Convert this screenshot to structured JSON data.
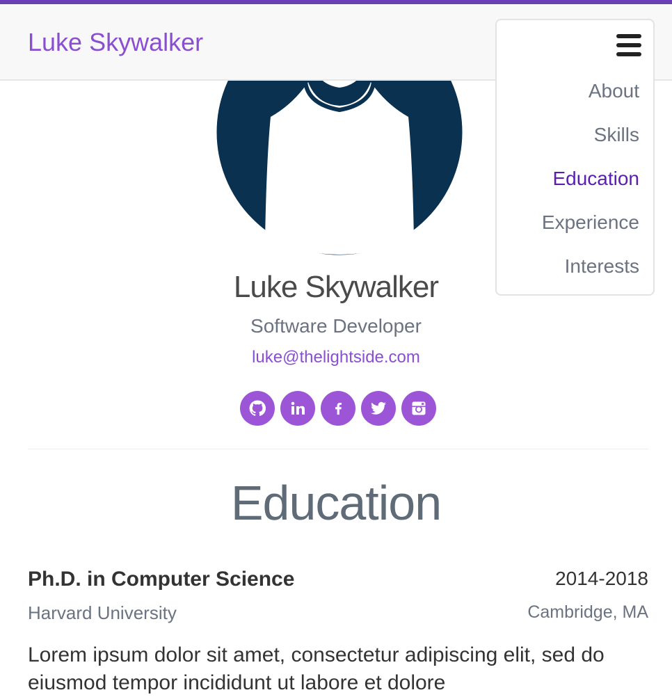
{
  "header": {
    "brand": "Luke Skywalker"
  },
  "nav": {
    "items": [
      {
        "label": "About",
        "active": false
      },
      {
        "label": "Skills",
        "active": false
      },
      {
        "label": "Education",
        "active": true
      },
      {
        "label": "Experience",
        "active": false
      },
      {
        "label": "Interests",
        "active": false
      }
    ],
    "toggle_icon": "hamburger-menu-icon"
  },
  "profile": {
    "name": "Luke Skywalker",
    "role": "Software Developer",
    "email": "luke@thelightside.com",
    "avatar_icon": "user-avatar-silhouette"
  },
  "socials": [
    {
      "icon": "github-icon"
    },
    {
      "icon": "linkedin-icon"
    },
    {
      "icon": "facebook-icon"
    },
    {
      "icon": "twitter-icon"
    },
    {
      "icon": "instagram-icon"
    }
  ],
  "education": {
    "title": "Education",
    "entries": [
      {
        "degree": "Ph.D. in Computer Science",
        "years": "2014-2018",
        "school": "Harvard University",
        "location": "Cambridge, MA",
        "description": "Lorem ipsum dolor sit amet, consectetur adipiscing elit, sed do eiusmod tempor incididunt ut labore et dolore"
      }
    ]
  },
  "colors": {
    "accent": "#8a4fd1",
    "active_nav": "#5a1fb0",
    "social_bg": "#9b55d6",
    "avatar": "#0b3150"
  }
}
